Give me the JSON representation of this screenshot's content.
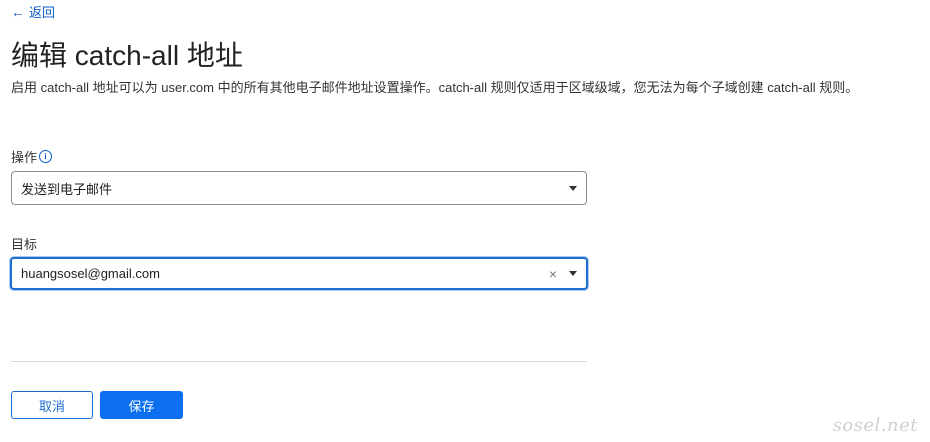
{
  "nav": {
    "back_label": "返回"
  },
  "page": {
    "title": "编辑 catch-all 地址",
    "description": "启用 catch-all 地址可以为 user.com 中的所有其他电子邮件地址设置操作。catch-all 规则仅适用于区域级域，您无法为每个子域创建 catch-all 规则。"
  },
  "form": {
    "action": {
      "label": "操作",
      "value": "发送到电子邮件"
    },
    "target": {
      "label": "目标",
      "value": "huangsosel@gmail.com"
    }
  },
  "buttons": {
    "cancel_label": "取消",
    "save_label": "保存"
  },
  "watermark": "sosel.net",
  "icons": {
    "back": "arrow-left-icon",
    "info": "info-icon",
    "caret": "caret-down-icon",
    "clear": "clear-icon"
  },
  "colors": {
    "link": "#0a5ec7",
    "primary": "#0b6ff0",
    "focus_border": "#1f6fd1"
  }
}
